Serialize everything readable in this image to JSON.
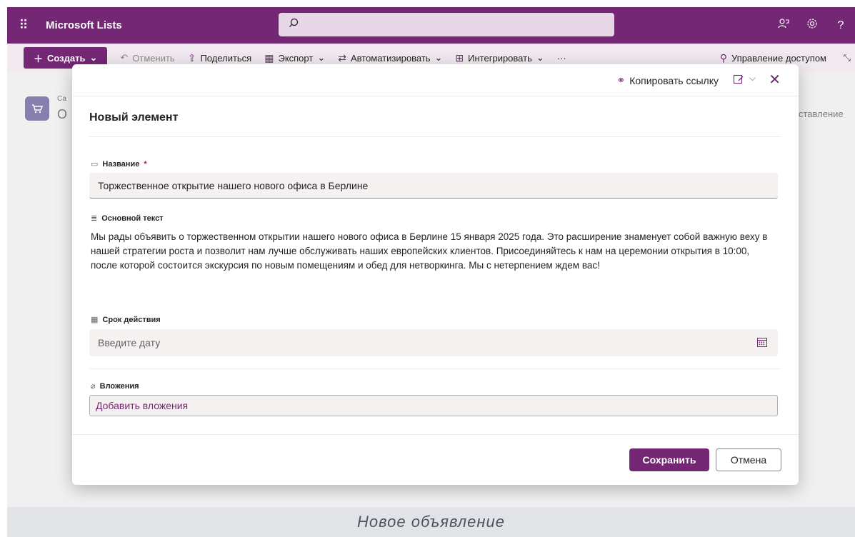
{
  "header": {
    "app_name": "Microsoft Lists",
    "search_value": "",
    "icons": [
      "waffle-icon",
      "search-icon",
      "feedback-icon",
      "settings-icon",
      "help-icon"
    ],
    "help_label": "?"
  },
  "command_bar": {
    "create": "Создать",
    "undo": "Отменить",
    "share": "Поделиться",
    "export": "Экспорт",
    "automate": "Автоматизировать",
    "integrate": "Интегрировать",
    "more": "···",
    "manage_access": "Управление доступом"
  },
  "background": {
    "breadcrumb_stub": "Са",
    "title_stub": "О",
    "view_stub": "ставление"
  },
  "modal": {
    "copy_link": "Копировать ссылку",
    "title": "Новый элемент",
    "fields": {
      "name_label": "Название",
      "name_required": "*",
      "name_value": "Торжественное открытие нашего нового офиса в Берлине",
      "body_label": "Основной текст",
      "body_value": "Мы рады объявить о торжественном открытии нашего нового офиса в Берлине 15 января 2025 года. Это расширение знаменует собой важную веху в нашей стратегии роста и позволит нам лучше обслуживать наших европейских клиентов. Присоединяйтесь к нам на церемонии открытия в 10:00, после которой состоится экскурсия по новым помещениям и обед для нетворкинга. Мы с нетерпением ждем вас!",
      "expiry_label": "Срок действия",
      "expiry_placeholder": "Введите дату",
      "attachments_label": "Вложения",
      "attachments_action": "Добавить вложения"
    },
    "save": "Сохранить",
    "cancel": "Отмена"
  },
  "caption": "Новое объявление",
  "colors": {
    "brand": "#742774",
    "required": "#c50f1f"
  }
}
